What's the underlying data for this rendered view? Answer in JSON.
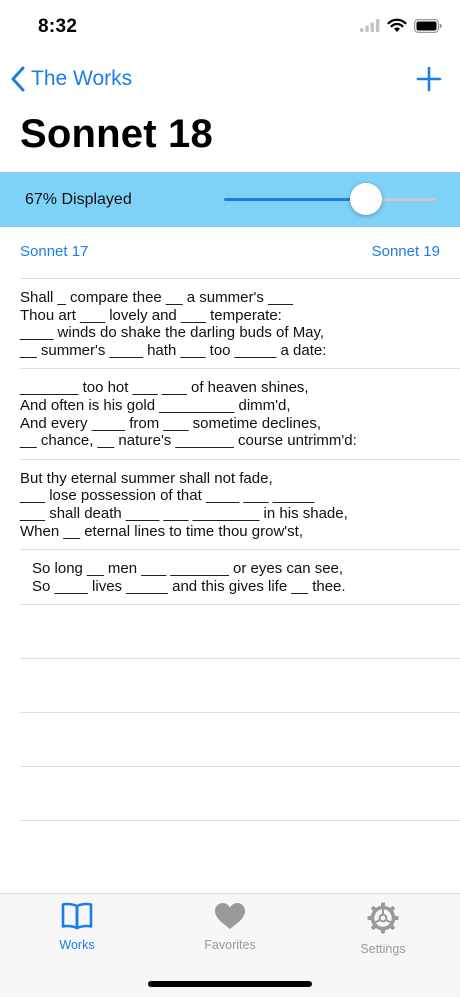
{
  "status": {
    "time": "8:32"
  },
  "nav": {
    "back_label": "The Works"
  },
  "title": "Sonnet 18",
  "display": {
    "label": "67% Displayed",
    "percent": 67
  },
  "links": {
    "prev": "Sonnet 17",
    "next": "Sonnet 19"
  },
  "stanzas": [
    {
      "lines": [
        "Shall _ compare thee __ a summer's ___",
        "Thou art ___ lovely and ___ temperate:",
        "____ winds do shake the darling buds of May,",
        "__ summer's ____ hath ___ too _____ a date:"
      ]
    },
    {
      "lines": [
        "_______ too hot ___ ___ of heaven shines,",
        "And often is his gold _________ dimm'd,",
        "And every ____ from ___ sometime declines,",
        "__ chance, __ nature's _______ course untrimm'd:"
      ]
    },
    {
      "lines": [
        "But thy eternal summer shall not fade,",
        "___ lose possession of that ____ ___ _____",
        "___ shall death ____ ___ ________ in his shade,",
        "When __ eternal lines to time thou grow'st,"
      ]
    },
    {
      "lines": [
        "So long __ men ___ _______ or eyes can see,",
        "So ____ lives _____ and this gives life __ thee."
      ]
    }
  ],
  "tabs": [
    {
      "label": "Works"
    },
    {
      "label": "Favorites"
    },
    {
      "label": "Settings"
    }
  ],
  "colors": {
    "accent": "#1a7ee8",
    "banner": "#7fd1f8",
    "inactive": "#9a9a9a"
  }
}
